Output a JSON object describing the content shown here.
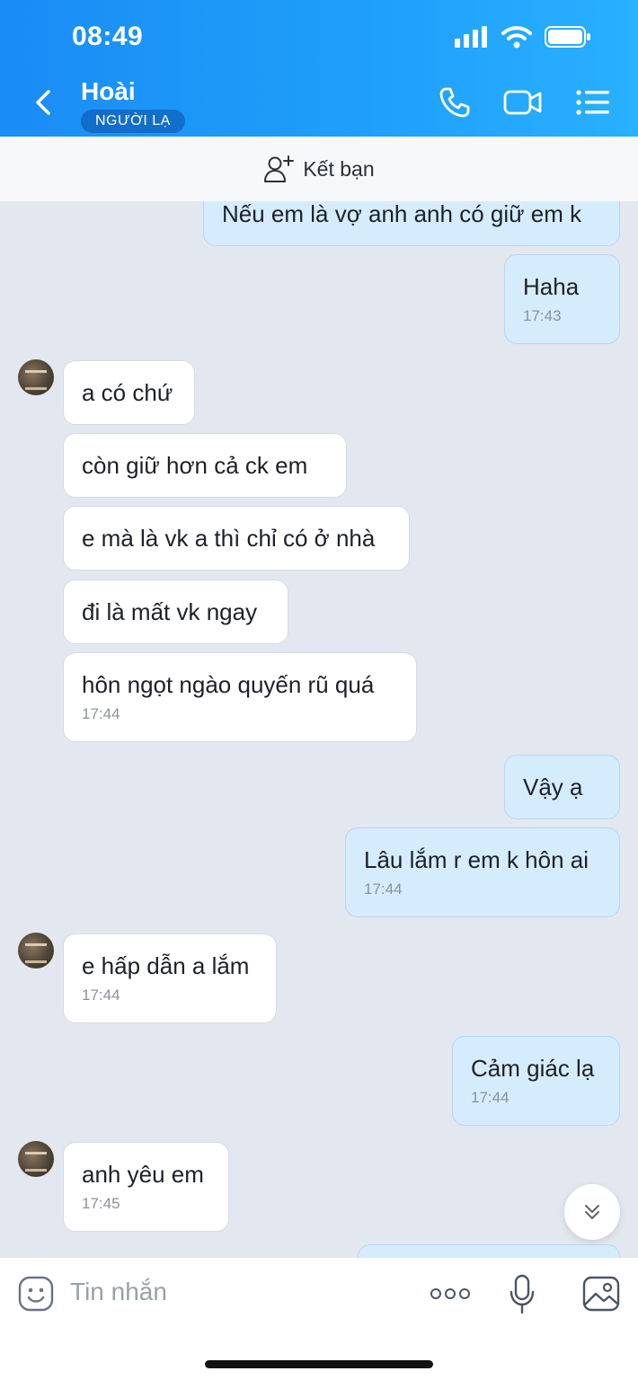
{
  "status_bar": {
    "time": "08:49"
  },
  "header": {
    "contact_name": "Hoài",
    "badge": "NGƯỜI LẠ"
  },
  "friend_bar": {
    "label": "Kết bạn"
  },
  "messages": [
    {
      "side": "me",
      "text": "Nếu em là vợ anh anh có giữ em k",
      "time": ""
    },
    {
      "side": "me",
      "text": "Haha",
      "time": "17:43"
    },
    {
      "side": "them",
      "text": "a có chứ",
      "time": ""
    },
    {
      "side": "them",
      "text": "còn giữ hơn cả ck em",
      "time": ""
    },
    {
      "side": "them",
      "text": "e mà là vk a thì chỉ có ở nhà",
      "time": ""
    },
    {
      "side": "them",
      "text": "đi là mất vk ngay",
      "time": ""
    },
    {
      "side": "them",
      "text": "hôn ngọt ngào quyến rũ quá",
      "time": "17:44"
    },
    {
      "side": "me",
      "text": "Vậy ạ",
      "time": ""
    },
    {
      "side": "me",
      "text": "Lâu lắm r em k hôn ai",
      "time": "17:44"
    },
    {
      "side": "them",
      "text": "e hấp dẫn a lắm",
      "time": "17:44"
    },
    {
      "side": "me",
      "text": "Cảm giác lạ",
      "time": "17:44"
    },
    {
      "side": "them",
      "text": "anh yêu em",
      "time": "17:45"
    }
  ],
  "composer": {
    "placeholder": "Tin nhắn"
  },
  "icons": {
    "back": "chevron-left-icon",
    "call": "phone-icon",
    "video": "video-camera-icon",
    "menu": "list-icon",
    "add_friend": "add-user-icon",
    "emoji": "emoji-icon",
    "more": "more-dots-icon",
    "mic": "microphone-icon",
    "image": "image-icon",
    "scroll": "double-chevron-down-icon"
  },
  "colors": {
    "header_start": "#1a8cf5",
    "header_end": "#29b0ff",
    "my_bubble": "#d5ecfd",
    "their_bubble": "#ffffff",
    "chat_bg": "#e3e7ef"
  }
}
